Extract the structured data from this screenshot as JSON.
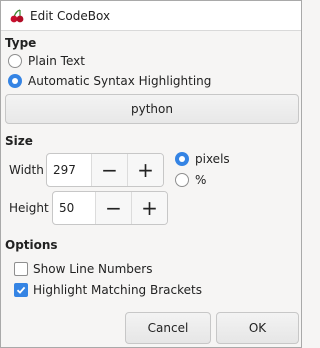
{
  "window": {
    "title": "Edit CodeBox",
    "icon": "cherry-icon"
  },
  "type_section": {
    "label": "Type",
    "options": [
      {
        "label": "Plain Text",
        "selected": false
      },
      {
        "label": "Automatic Syntax Highlighting",
        "selected": true
      }
    ],
    "language_button": "python"
  },
  "size_section": {
    "label": "Size",
    "width": {
      "label": "Width",
      "value": "297"
    },
    "height": {
      "label": "Height",
      "value": "50"
    },
    "units": [
      {
        "label": "pixels",
        "selected": true
      },
      {
        "label": "%",
        "selected": false
      }
    ],
    "decrement_symbol": "−",
    "increment_symbol": "+"
  },
  "options_section": {
    "label": "Options",
    "checkboxes": [
      {
        "label": "Show Line Numbers",
        "checked": false
      },
      {
        "label": "Highlight Matching Brackets",
        "checked": true
      }
    ]
  },
  "buttons": {
    "cancel": "Cancel",
    "ok": "OK"
  },
  "colors": {
    "accent": "#3584e4",
    "cherry": "#c8102e",
    "stem": "#3a8a2e"
  }
}
